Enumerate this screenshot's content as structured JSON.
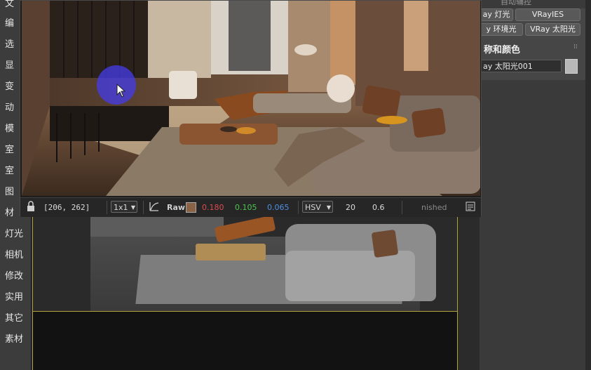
{
  "left_menu": {
    "items": [
      "文",
      "编",
      "选",
      "显",
      "变",
      "动",
      "模",
      "室",
      "室",
      "图",
      "材",
      "灯光",
      "相机",
      "修改",
      "实用",
      "其它",
      "素材"
    ]
  },
  "frame_buffer": {
    "coords": "[206, 262]",
    "ratio": "1x1",
    "color_mode": "Raw",
    "r_value": "0.180",
    "g_value": "0.105",
    "b_value": "0.065",
    "space": "HSV",
    "value_a": "20",
    "value_b": "0.6",
    "status": "nished",
    "colors": {
      "r": "#d94c4c",
      "g": "#4fc24f",
      "b": "#4f8fe0",
      "swatch": "#8a6347"
    }
  },
  "right_panel": {
    "top_partial": "自动辅控",
    "buttons": [
      "ay 灯光",
      "VRayIES",
      "y 环境光",
      "VRay 太阳光"
    ],
    "section_title": "称和颜色",
    "name_value": "ay 太阳光001",
    "swatch_color": "#b8b8b8"
  }
}
